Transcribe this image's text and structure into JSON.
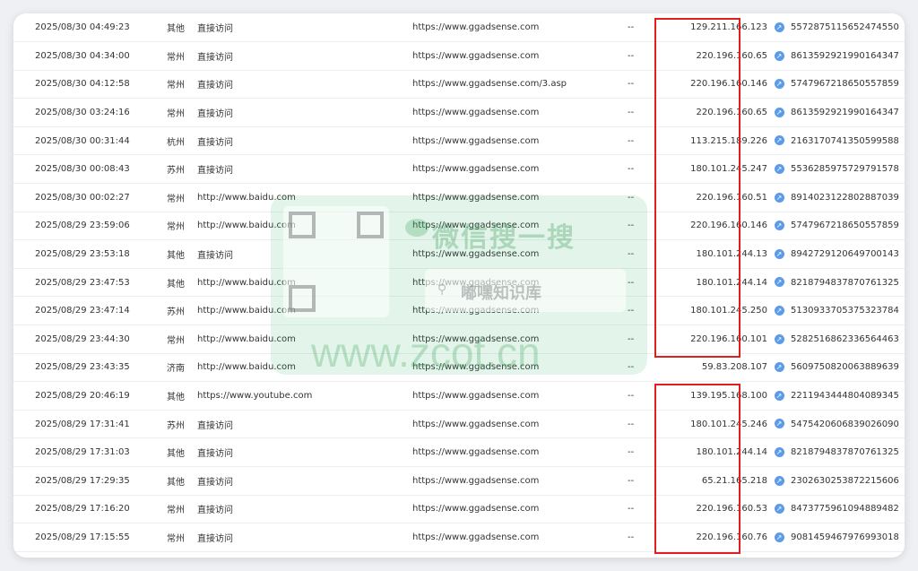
{
  "rows": [
    {
      "time": "2025/08/30 04:49:23",
      "location": "其他",
      "source": "直接访问",
      "page": "https://www.ggadsense.com",
      "keyword": "--",
      "ip": "129.211.166.123",
      "visitor_id": "5572875115652474550"
    },
    {
      "time": "2025/08/30 04:34:00",
      "location": "常州",
      "source": "直接访问",
      "page": "https://www.ggadsense.com",
      "keyword": "--",
      "ip": "220.196.160.65",
      "visitor_id": "8613592921990164347"
    },
    {
      "time": "2025/08/30 04:12:58",
      "location": "常州",
      "source": "直接访问",
      "page": "https://www.ggadsense.com/3.asp",
      "keyword": "--",
      "ip": "220.196.160.146",
      "visitor_id": "5747967218650557859"
    },
    {
      "time": "2025/08/30 03:24:16",
      "location": "常州",
      "source": "直接访问",
      "page": "https://www.ggadsense.com",
      "keyword": "--",
      "ip": "220.196.160.65",
      "visitor_id": "8613592921990164347"
    },
    {
      "time": "2025/08/30 00:31:44",
      "location": "杭州",
      "source": "直接访问",
      "page": "https://www.ggadsense.com",
      "keyword": "--",
      "ip": "113.215.189.226",
      "visitor_id": "2163170741350599588"
    },
    {
      "time": "2025/08/30 00:08:43",
      "location": "苏州",
      "source": "直接访问",
      "page": "https://www.ggadsense.com",
      "keyword": "--",
      "ip": "180.101.245.247",
      "visitor_id": "5536285975729791578"
    },
    {
      "time": "2025/08/30 00:02:27",
      "location": "常州",
      "source": "http://www.baidu.com",
      "page": "https://www.ggadsense.com",
      "keyword": "--",
      "ip": "220.196.160.51",
      "visitor_id": "8914023122802887039"
    },
    {
      "time": "2025/08/29 23:59:06",
      "location": "常州",
      "source": "http://www.baidu.com",
      "page": "https://www.ggadsense.com",
      "keyword": "--",
      "ip": "220.196.160.146",
      "visitor_id": "5747967218650557859"
    },
    {
      "time": "2025/08/29 23:53:18",
      "location": "其他",
      "source": "直接访问",
      "page": "https://www.ggadsense.com",
      "keyword": "--",
      "ip": "180.101.244.13",
      "visitor_id": "8942729120649700143"
    },
    {
      "time": "2025/08/29 23:47:53",
      "location": "其他",
      "source": "http://www.baidu.com",
      "page": "https://www.ggadsense.com",
      "keyword": "--",
      "ip": "180.101.244.14",
      "visitor_id": "8218794837870761325"
    },
    {
      "time": "2025/08/29 23:47:14",
      "location": "苏州",
      "source": "http://www.baidu.com",
      "page": "https://www.ggadsense.com",
      "keyword": "--",
      "ip": "180.101.245.250",
      "visitor_id": "5130933705375323784"
    },
    {
      "time": "2025/08/29 23:44:30",
      "location": "常州",
      "source": "http://www.baidu.com",
      "page": "https://www.ggadsense.com",
      "keyword": "--",
      "ip": "220.196.160.101",
      "visitor_id": "5282516862336564463"
    },
    {
      "time": "2025/08/29 23:43:35",
      "location": "济南",
      "source": "http://www.baidu.com",
      "page": "https://www.ggadsense.com",
      "keyword": "--",
      "ip": "59.83.208.107",
      "visitor_id": "5609750820063889639"
    },
    {
      "time": "2025/08/29 20:46:19",
      "location": "其他",
      "source": "https://www.youtube.com",
      "page": "https://www.ggadsense.com",
      "keyword": "--",
      "ip": "139.195.168.100",
      "visitor_id": "2211943444804089345"
    },
    {
      "time": "2025/08/29 17:31:41",
      "location": "苏州",
      "source": "直接访问",
      "page": "https://www.ggadsense.com",
      "keyword": "--",
      "ip": "180.101.245.246",
      "visitor_id": "5475420606839026090"
    },
    {
      "time": "2025/08/29 17:31:03",
      "location": "其他",
      "source": "直接访问",
      "page": "https://www.ggadsense.com",
      "keyword": "--",
      "ip": "180.101.244.14",
      "visitor_id": "8218794837870761325"
    },
    {
      "time": "2025/08/29 17:29:35",
      "location": "其他",
      "source": "直接访问",
      "page": "https://www.ggadsense.com",
      "keyword": "--",
      "ip": "65.21.165.218",
      "visitor_id": "2302630253872215606"
    },
    {
      "time": "2025/08/29 17:16:20",
      "location": "常州",
      "source": "直接访问",
      "page": "https://www.ggadsense.com",
      "keyword": "--",
      "ip": "220.196.160.53",
      "visitor_id": "8473775961094889482"
    },
    {
      "time": "2025/08/29 17:15:55",
      "location": "常州",
      "source": "直接访问",
      "page": "https://www.ggadsense.com",
      "keyword": "--",
      "ip": "220.196.160.76",
      "visitor_id": "9081459467976993018"
    }
  ],
  "watermark": {
    "brand": "微信搜一搜",
    "search_text": "嘟嘿知识库",
    "url": "www.zcot.cn"
  },
  "colors": {
    "link": "#3a7bd5",
    "highlight": "#e01e1e",
    "icon": "#5b9be8"
  },
  "icons": {
    "ip_action": "link-icon",
    "visitor_action": "link-icon"
  }
}
